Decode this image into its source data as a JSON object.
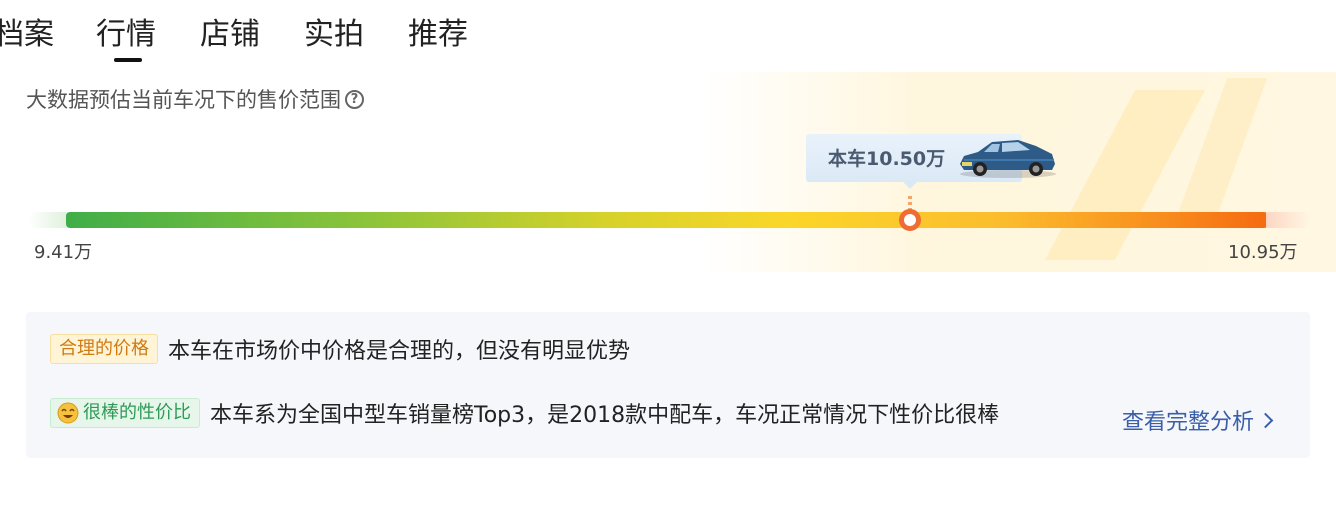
{
  "tabs": [
    {
      "label": "档案"
    },
    {
      "label": "行情",
      "active": true
    },
    {
      "label": "店铺"
    },
    {
      "label": "实拍"
    },
    {
      "label": "推荐"
    }
  ],
  "price": {
    "subtitle": "大数据预估当前车况下的售价范围",
    "help_icon": "question-circle-icon",
    "tooltip": "本车10.50万",
    "min_label": "9.41万",
    "max_label": "10.95万",
    "min_value": 9.41,
    "max_value": 10.95,
    "current_value": 10.5,
    "colors": {
      "low": "#3fae48",
      "mid": "#fbd62a",
      "high": "#f56a10",
      "marker": "#ee6d32"
    }
  },
  "analysis": {
    "rows": [
      {
        "badge": "合理的价格",
        "text": "本车在市场价中价格是合理的，但没有明显优势"
      },
      {
        "badge": "很棒的性价比",
        "badge_icon": "smile-face-icon",
        "text": "本车系为全国中型车销量榜Top3，是2018款中配车，车况正常情况下性价比很棒"
      }
    ],
    "link": "查看完整分析"
  }
}
